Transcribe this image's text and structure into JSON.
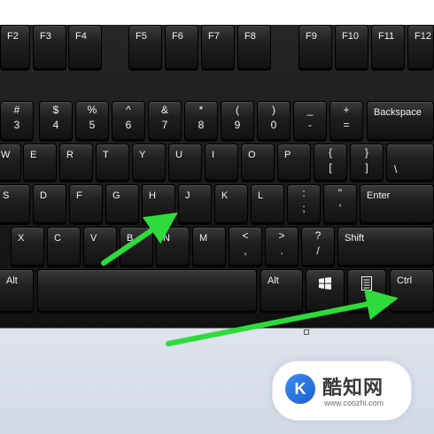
{
  "function_row_1": [
    "F2",
    "F3",
    "F4"
  ],
  "function_row_2": [
    "F5",
    "F6",
    "F7",
    "F8"
  ],
  "function_row_3": [
    "F9",
    "F10",
    "F11",
    "F12"
  ],
  "number_row": [
    {
      "top": "#",
      "bottom": "3"
    },
    {
      "top": "$",
      "bottom": "4"
    },
    {
      "top": "%",
      "bottom": "5"
    },
    {
      "top": "^",
      "bottom": "6"
    },
    {
      "top": "&",
      "bottom": "7"
    },
    {
      "top": "*",
      "bottom": "8"
    },
    {
      "top": "(",
      "bottom": "9"
    },
    {
      "top": ")",
      "bottom": "0"
    },
    {
      "top": "_",
      "bottom": "-"
    },
    {
      "top": "+",
      "bottom": "="
    }
  ],
  "backspace": "Backspace",
  "top_letter_row": [
    "W",
    "E",
    "R",
    "T",
    "Y",
    "U",
    "I",
    "O",
    "P"
  ],
  "bracket_keys": [
    {
      "top": "{",
      "bottom": "["
    },
    {
      "top": "}",
      "bottom": "]"
    }
  ],
  "backslash": "\\",
  "home_row": [
    "S",
    "D",
    "F",
    "G",
    "H",
    "J",
    "K",
    "L"
  ],
  "semicolon_key": {
    "top": ":",
    "bottom": ";"
  },
  "quote_key": {
    "top": "\"",
    "bottom": "'"
  },
  "enter": "Enter",
  "bottom_letter_row": [
    "X",
    "C",
    "V",
    "B",
    "N",
    "M"
  ],
  "punct_keys": [
    {
      "top": "<",
      "bottom": ","
    },
    {
      "top": ">",
      "bottom": "."
    },
    {
      "top": "?",
      "bottom": "/"
    }
  ],
  "shift": "Shift",
  "alt_left": "Alt",
  "alt_right": "Alt",
  "ctrl": "Ctrl",
  "watermark": {
    "logo_letter": "K",
    "name": "酷知网",
    "url": "www.coozhi.com"
  },
  "colors": {
    "key_text": "#f2f2f2",
    "arrow": "#2ddc3a"
  },
  "icons": [
    "windows-logo-icon",
    "menu-icon"
  ]
}
